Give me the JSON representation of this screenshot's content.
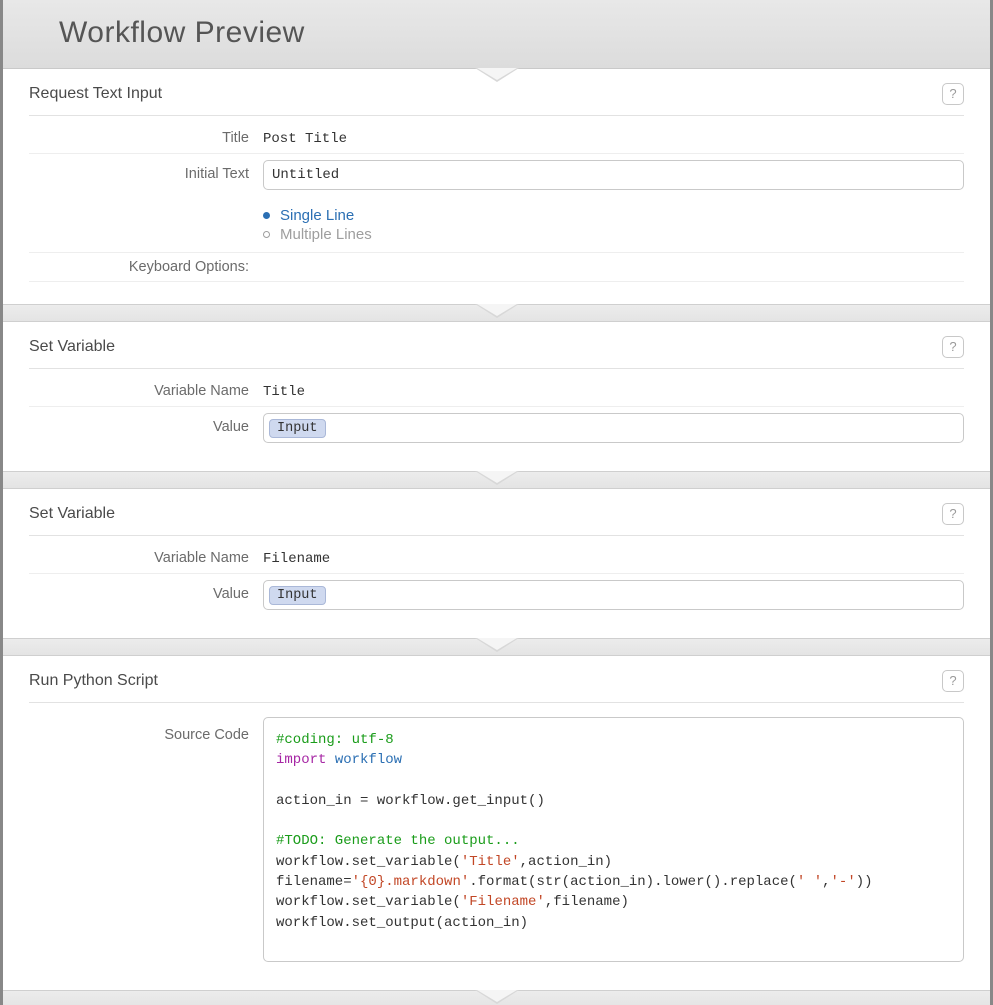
{
  "header": {
    "title": "Workflow Preview"
  },
  "help_symbol": "?",
  "blocks": {
    "request_text": {
      "title": "Request Text Input",
      "labels": {
        "title": "Title",
        "initial_text": "Initial Text",
        "keyboard_options": "Keyboard Options:"
      },
      "title_value": "Post Title",
      "initial_text_value": "Untitled",
      "options": {
        "single": "Single Line",
        "multiple": "Multiple Lines"
      },
      "keyboard_options_value": ""
    },
    "set_var_1": {
      "title": "Set Variable",
      "labels": {
        "variable_name": "Variable Name",
        "value": "Value"
      },
      "variable_name": "Title",
      "value_token": "Input"
    },
    "set_var_2": {
      "title": "Set Variable",
      "labels": {
        "variable_name": "Variable Name",
        "value": "Value"
      },
      "variable_name": "Filename",
      "value_token": "Input"
    },
    "python": {
      "title": "Run Python Script",
      "labels": {
        "source_code": "Source Code"
      },
      "code": {
        "l1": "#coding: utf-8",
        "l2a": "import",
        "l2b": "workflow",
        "l3": "action_in = workflow.get_input()",
        "l4": "#TODO: Generate the output...",
        "l5a": "workflow.set_variable(",
        "l5b": "'Title'",
        "l5c": ",action_in)",
        "l6a": "filename=",
        "l6b": "'{0}.markdown'",
        "l6c": ".format(str(action_in).lower().replace(",
        "l6d": "' '",
        "l6e": ",",
        "l6f": "'-'",
        "l6g": "))",
        "l7a": "workflow.set_variable(",
        "l7b": "'Filename'",
        "l7c": ",filename)",
        "l8": "workflow.set_output(action_in)"
      }
    }
  }
}
